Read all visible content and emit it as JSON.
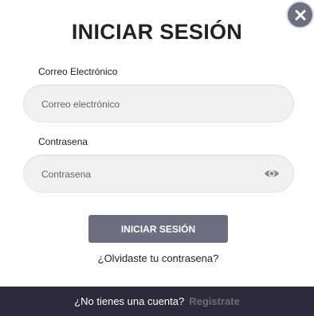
{
  "modal": {
    "title": "INICIAR SESIÓN",
    "close_icon": "close-icon"
  },
  "email": {
    "label": "Correo Electrónico",
    "placeholder": "Correo electrónico",
    "value": ""
  },
  "password": {
    "label": "Contrasena",
    "placeholder": "Contrasena",
    "value": "",
    "toggle_icon": "eye-icon"
  },
  "submit_label": "INICIAR SESIÓN",
  "forgot_label": "¿Olvidaste tu contrasena?",
  "footer": {
    "question": "¿No tienes una cuenta?",
    "register_label": "Registrate"
  },
  "colors": {
    "accent": "#6b6f80",
    "footer_bg": "#2d2b3b",
    "register_link": "#6a6c7a"
  }
}
